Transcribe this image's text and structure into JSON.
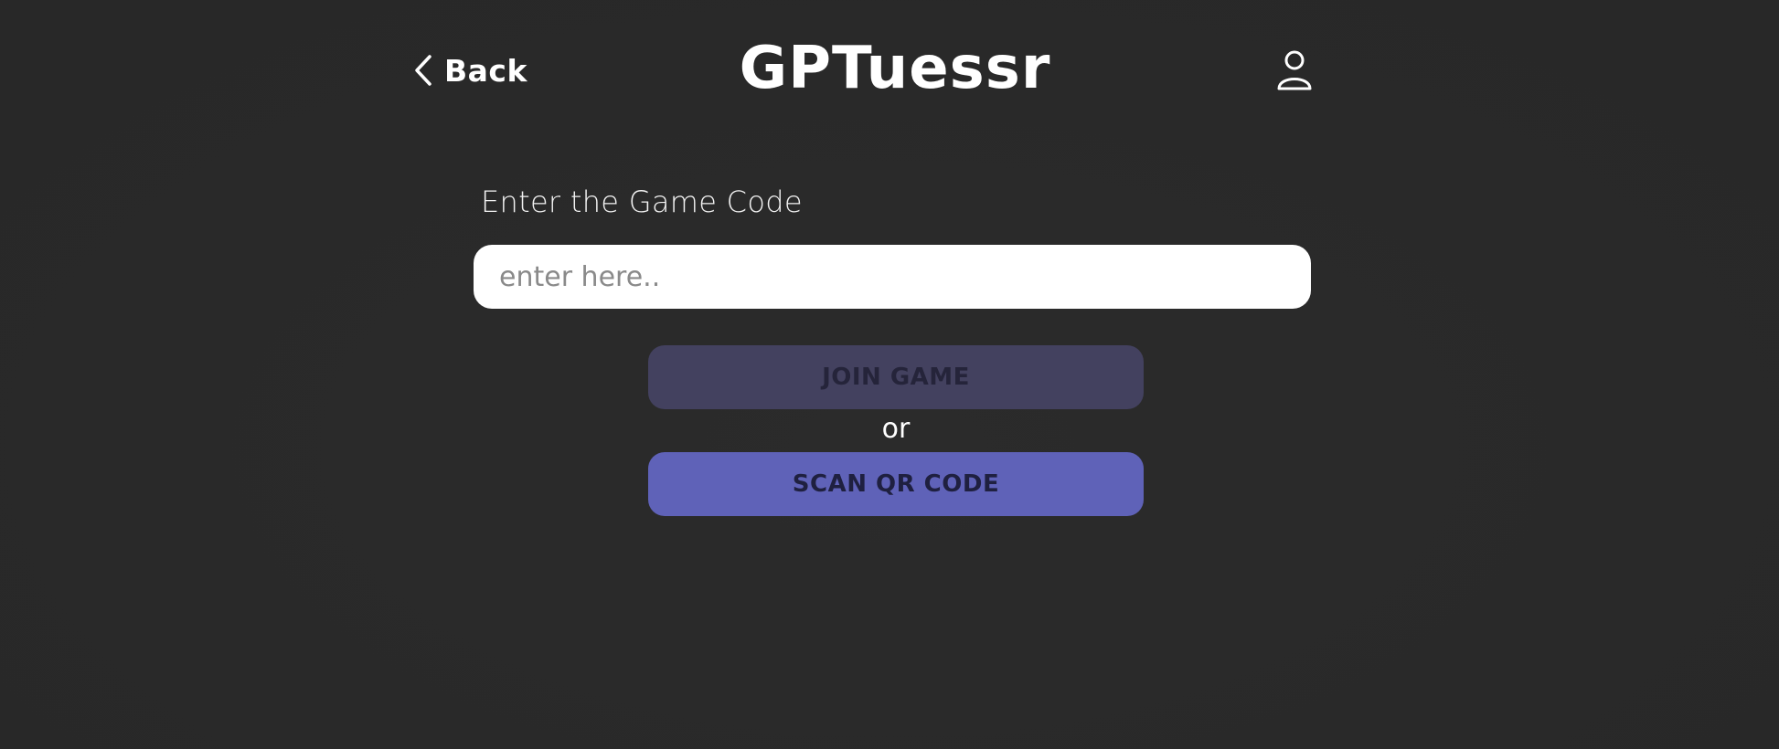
{
  "header": {
    "back_label": "Back",
    "title": "GPTuessr",
    "back_icon": "chevron-left-icon",
    "profile_icon": "user-icon"
  },
  "form": {
    "label": "Enter the Game Code",
    "input_placeholder": "enter here..",
    "input_value": "",
    "join_button_label": "JOIN GAME",
    "join_button_state": "disabled",
    "separator": "or",
    "scan_button_label": "SCAN QR CODE"
  },
  "colors": {
    "background": "#2a2a2a",
    "join_button_bg": "#43415f",
    "scan_button_bg": "#5f62b8",
    "input_bg": "#ffffff"
  }
}
